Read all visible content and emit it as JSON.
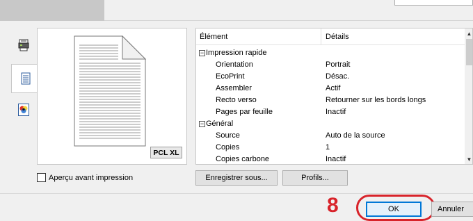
{
  "preview": {
    "badge": "PCL XL"
  },
  "side_tabs": [
    {
      "icon": "printer-settings-icon"
    },
    {
      "icon": "document-icon"
    },
    {
      "icon": "color-icon"
    }
  ],
  "details": {
    "header": {
      "element": "Élément",
      "details": "Détails"
    },
    "rows": [
      {
        "type": "group",
        "expander": "⊟",
        "name": "Impression rapide",
        "value": ""
      },
      {
        "type": "item",
        "name": "Orientation",
        "value": "Portrait"
      },
      {
        "type": "item",
        "name": "EcoPrint",
        "value": "Désac."
      },
      {
        "type": "item",
        "name": "Assembler",
        "value": "Actif"
      },
      {
        "type": "item",
        "name": "Recto verso",
        "value": "Retourner sur les bords longs"
      },
      {
        "type": "item",
        "name": "Pages par feuille",
        "value": "Inactif"
      },
      {
        "type": "group",
        "expander": "⊟",
        "name": "Général",
        "value": ""
      },
      {
        "type": "item",
        "name": "Source",
        "value": "Auto de la source"
      },
      {
        "type": "item",
        "name": "Copies",
        "value": "1"
      },
      {
        "type": "item",
        "name": "Copies carbone",
        "value": "Inactif"
      }
    ]
  },
  "preview_checkbox": {
    "label": "Aperçu avant impression",
    "checked": false
  },
  "buttons": {
    "save_as": "Enregistrer sous...",
    "profiles": "Profils...",
    "ok": "OK",
    "cancel": "Annuler"
  },
  "callout": {
    "step": "8",
    "color": "#d8232a"
  },
  "colors": {
    "focus_border": "#0078d7",
    "highlight": "#d8232a"
  }
}
